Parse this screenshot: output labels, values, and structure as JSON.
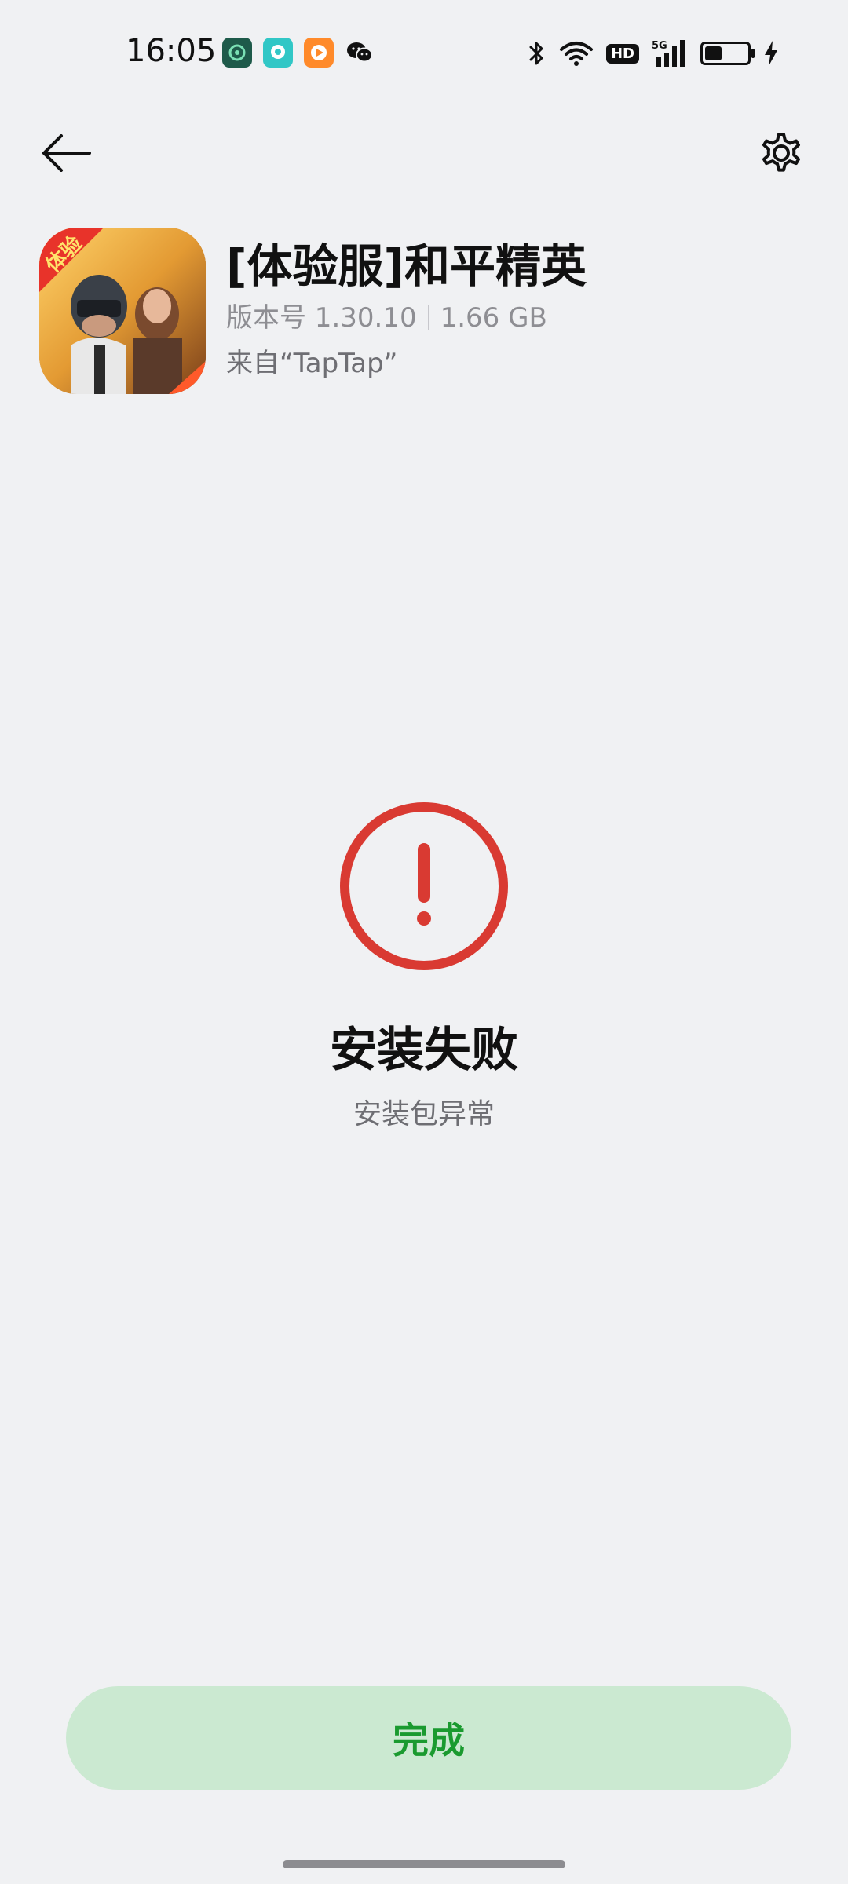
{
  "status_bar": {
    "time": "16:05",
    "notification_icons": [
      "game-assistant-icon",
      "chat-bubble-icon",
      "video-play-icon",
      "wechat-icon"
    ],
    "system_icons": [
      "bluetooth-icon",
      "wifi-icon",
      "hd-icon",
      "signal-5g-icon",
      "battery-icon",
      "charging-icon"
    ],
    "hd_label": "HD",
    "battery_level_fraction": 0.4
  },
  "toolbar": {
    "back_icon": "arrow-left-icon",
    "settings_icon": "gear-icon"
  },
  "app": {
    "name": "[体验服]和平精英",
    "version": "版本号 1.30.10",
    "size": "1.66 GB",
    "source": "来自“TapTap”",
    "icon_badge": "体验"
  },
  "result": {
    "icon": "exclamation-circle-icon",
    "title": "安装失败",
    "subtitle": "安装包异常"
  },
  "actions": {
    "done_label": "完成"
  },
  "colors": {
    "background": "#f0f1f3",
    "error_red": "#d93a32",
    "done_bg": "#cbe9d1",
    "done_text": "#1a9a2f"
  }
}
